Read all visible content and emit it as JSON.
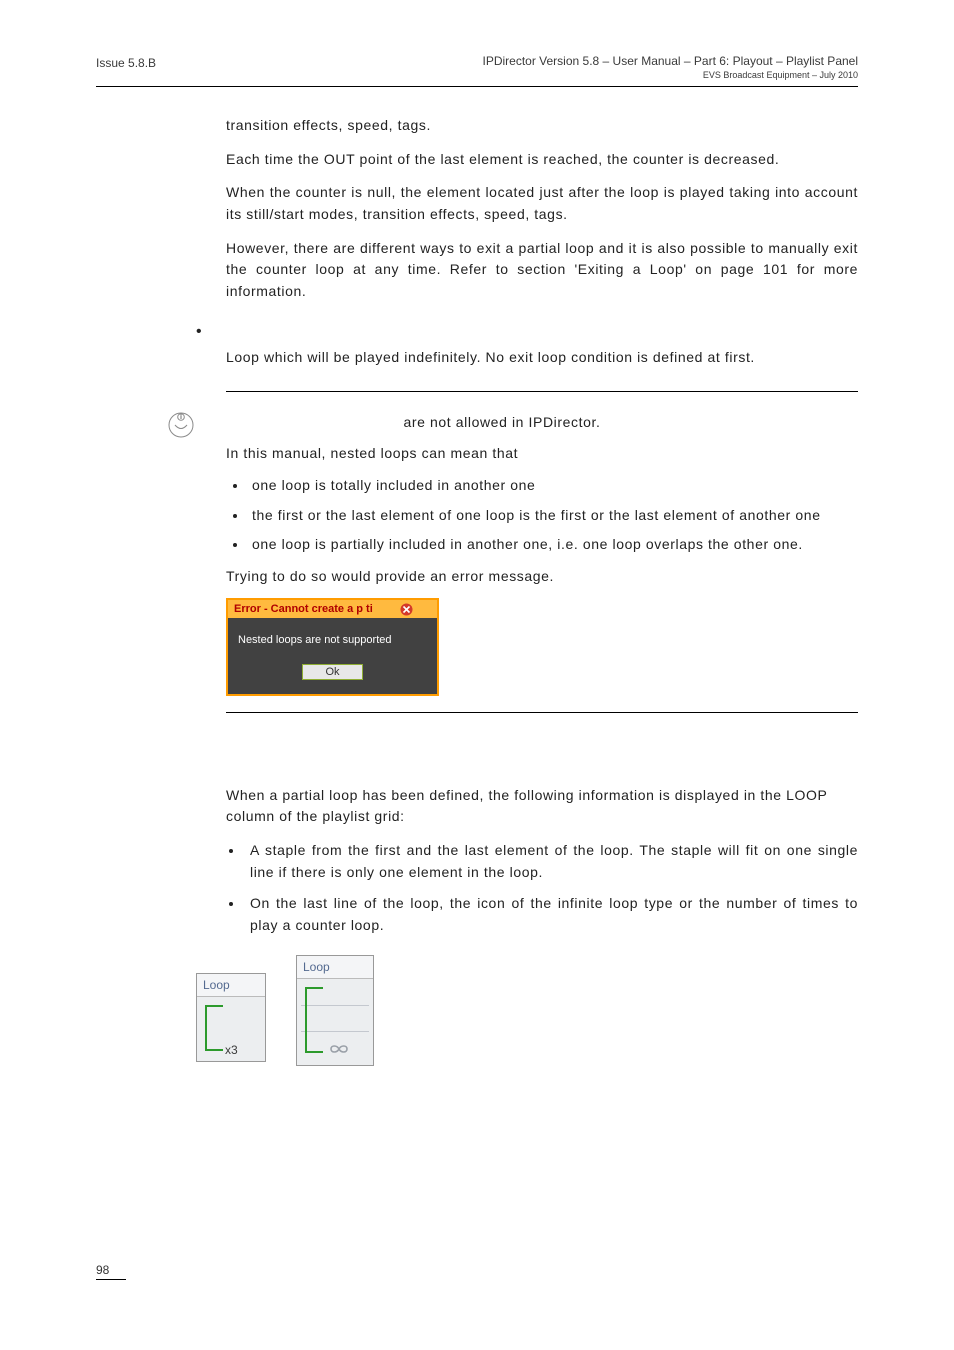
{
  "header": {
    "left": "Issue 5.8.B",
    "right_main": "IPDirector Version 5.8 – User Manual – Part 6: Playout – Playlist Panel",
    "right_sub": "EVS Broadcast Equipment – July 2010"
  },
  "body": {
    "p1": "transition effects, speed, tags.",
    "p2": "Each time the OUT point of the last element is reached, the counter is decreased.",
    "p3": "When the counter is null, the element located just after the loop is played taking into account its still/start modes, transition effects, speed, tags.",
    "p4": "However, there are different ways to exit a partial loop and it is also possible to manually exit the counter loop at any time. Refer to section 'Exiting a Loop' on page 101 for more information.",
    "p5": "Loop which will be played indefinitely. No exit loop condition is defined at first."
  },
  "note": {
    "line1": " are not allowed in IPDirector.",
    "line2": "In this manual, nested loops can mean that",
    "items": [
      "one loop is totally included in another one",
      "the first or the last element of one loop is the first or the last element of another one",
      "one loop is partially included in another one, i.e. one loop overlaps the other one."
    ],
    "line3": "Trying to do so would provide an error message."
  },
  "error_dialog": {
    "title": "Error - Cannot create a p     ti",
    "body": "Nested loops are not supported",
    "ok": "Ok"
  },
  "section": {
    "intro": "When a partial loop has been defined, the following information is displayed in the LOOP column of the playlist grid:",
    "items": [
      "A staple from the first and the last element of the loop. The staple will fit on one single line if there is only one element in the loop.",
      "On the last line of the loop, the icon of the infinite loop type or the number of times to play a counter loop."
    ]
  },
  "loop_fig": {
    "header": "Loop",
    "counter_tag": "x3"
  },
  "footer": {
    "page": "98"
  }
}
